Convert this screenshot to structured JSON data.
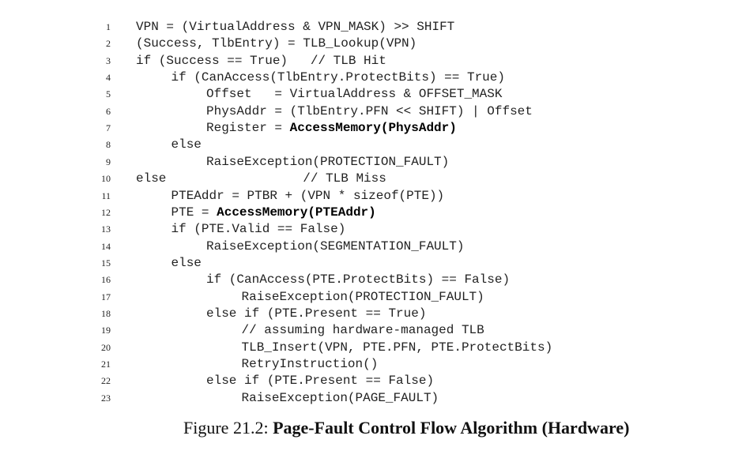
{
  "code_lines": [
    {
      "n": "1",
      "indent": 0,
      "parts": [
        {
          "t": "VPN = (VirtualAddress & VPN_MASK) >> SHIFT"
        }
      ]
    },
    {
      "n": "2",
      "indent": 0,
      "parts": [
        {
          "t": "(Success, TlbEntry) = TLB_Lookup(VPN)"
        }
      ]
    },
    {
      "n": "3",
      "indent": 0,
      "parts": [
        {
          "t": "if (Success == True)   // TLB Hit"
        }
      ]
    },
    {
      "n": "4",
      "indent": 1,
      "parts": [
        {
          "t": "if (CanAccess(TlbEntry.ProtectBits) == True)"
        }
      ]
    },
    {
      "n": "5",
      "indent": 2,
      "parts": [
        {
          "t": "Offset   = VirtualAddress & OFFSET_MASK"
        }
      ]
    },
    {
      "n": "6",
      "indent": 2,
      "parts": [
        {
          "t": "PhysAddr = (TlbEntry.PFN << SHIFT) | Offset"
        }
      ]
    },
    {
      "n": "7",
      "indent": 2,
      "parts": [
        {
          "t": "Register = "
        },
        {
          "t": "AccessMemory(PhysAddr)",
          "b": true
        }
      ]
    },
    {
      "n": "8",
      "indent": 1,
      "parts": [
        {
          "t": "else"
        }
      ]
    },
    {
      "n": "9",
      "indent": 2,
      "parts": [
        {
          "t": "RaiseException(PROTECTION_FAULT)"
        }
      ]
    },
    {
      "n": "10",
      "indent": 0,
      "parts": [
        {
          "t": "else                  // TLB Miss"
        }
      ]
    },
    {
      "n": "11",
      "indent": 1,
      "parts": [
        {
          "t": "PTEAddr = PTBR + (VPN * sizeof(PTE))"
        }
      ]
    },
    {
      "n": "12",
      "indent": 1,
      "parts": [
        {
          "t": "PTE = "
        },
        {
          "t": "AccessMemory(PTEAddr)",
          "b": true
        }
      ]
    },
    {
      "n": "13",
      "indent": 1,
      "parts": [
        {
          "t": "if (PTE.Valid == False)"
        }
      ]
    },
    {
      "n": "14",
      "indent": 2,
      "parts": [
        {
          "t": "RaiseException(SEGMENTATION_FAULT)"
        }
      ]
    },
    {
      "n": "15",
      "indent": 1,
      "parts": [
        {
          "t": "else"
        }
      ]
    },
    {
      "n": "16",
      "indent": 2,
      "parts": [
        {
          "t": "if (CanAccess(PTE.ProtectBits) == False)"
        }
      ]
    },
    {
      "n": "17",
      "indent": 3,
      "parts": [
        {
          "t": "RaiseException(PROTECTION_FAULT)"
        }
      ]
    },
    {
      "n": "18",
      "indent": 2,
      "parts": [
        {
          "t": "else if (PTE.Present == True)"
        }
      ]
    },
    {
      "n": "19",
      "indent": 3,
      "parts": [
        {
          "t": "// assuming hardware-managed TLB"
        }
      ]
    },
    {
      "n": "20",
      "indent": 3,
      "parts": [
        {
          "t": "TLB_Insert(VPN, PTE.PFN, PTE.ProtectBits)"
        }
      ]
    },
    {
      "n": "21",
      "indent": 3,
      "parts": [
        {
          "t": "RetryInstruction()"
        }
      ]
    },
    {
      "n": "22",
      "indent": 2,
      "parts": [
        {
          "t": "else if (PTE.Present == False)"
        }
      ]
    },
    {
      "n": "23",
      "indent": 3,
      "parts": [
        {
          "t": "RaiseException(PAGE_FAULT)"
        }
      ]
    }
  ],
  "caption": {
    "label": "Figure 21.2: ",
    "title": "Page-Fault Control Flow Algorithm (Hardware)"
  }
}
